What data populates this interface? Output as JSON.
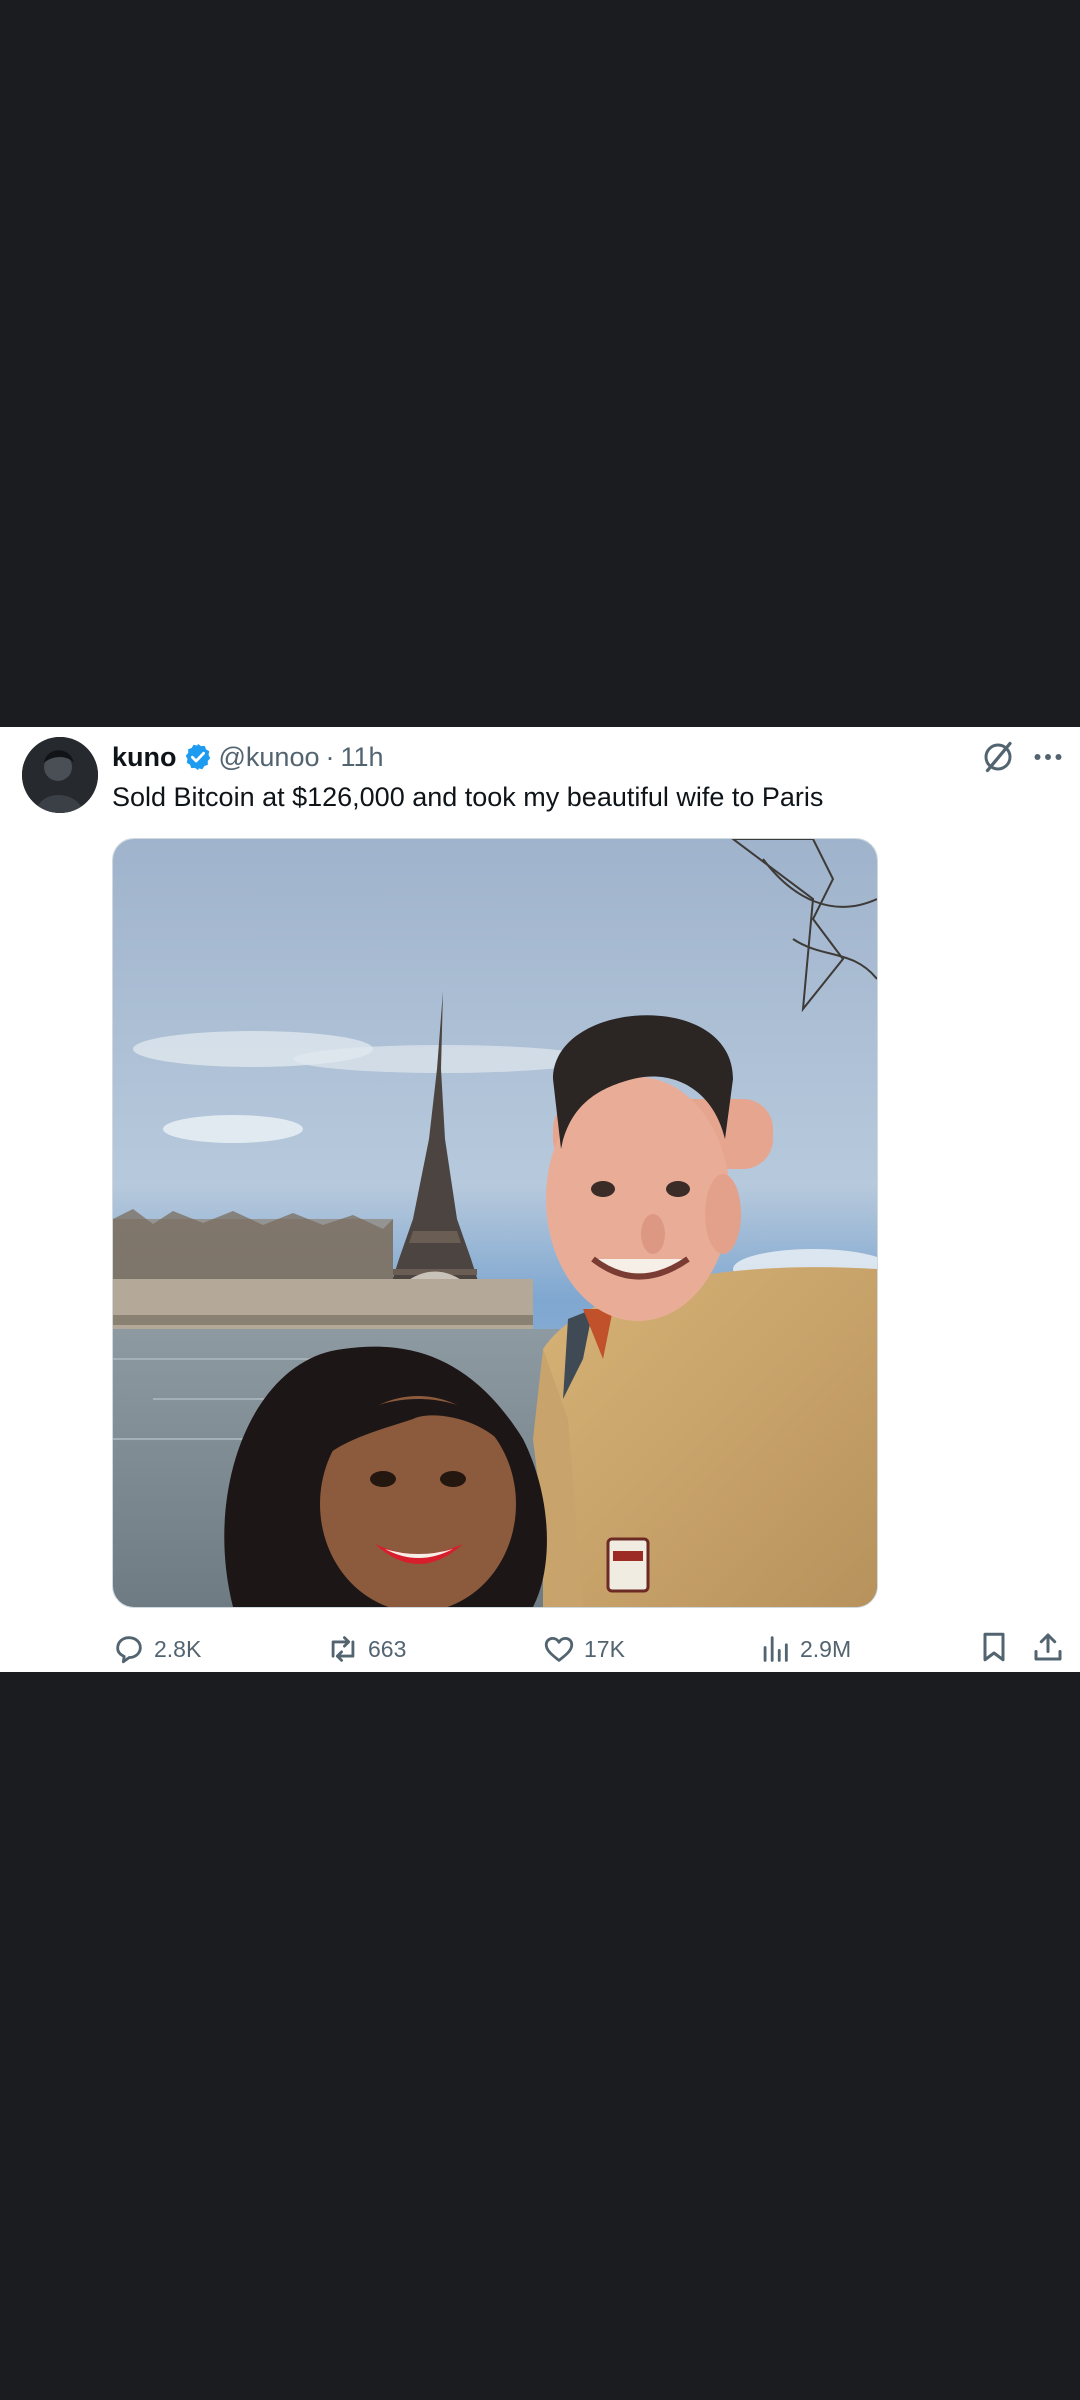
{
  "tweet": {
    "author_name": "kuno",
    "handle": "@kunoo",
    "separator": "·",
    "time": "11h",
    "text": "Sold Bitcoin at $126,000 and took my beautiful wife to Paris"
  },
  "metrics": {
    "replies": "2.8K",
    "reposts": "663",
    "likes": "17K",
    "views": "2.9M"
  },
  "colors": {
    "background": "#1b1c20",
    "card": "#ffffff",
    "verified": "#1d9bf0",
    "text": "#0f1419",
    "secondary": "#536471"
  },
  "icons": [
    "verified-badge-icon",
    "grok-icon",
    "more-icon",
    "reply-icon",
    "repost-icon",
    "like-icon",
    "views-icon",
    "bookmark-icon",
    "share-icon"
  ]
}
